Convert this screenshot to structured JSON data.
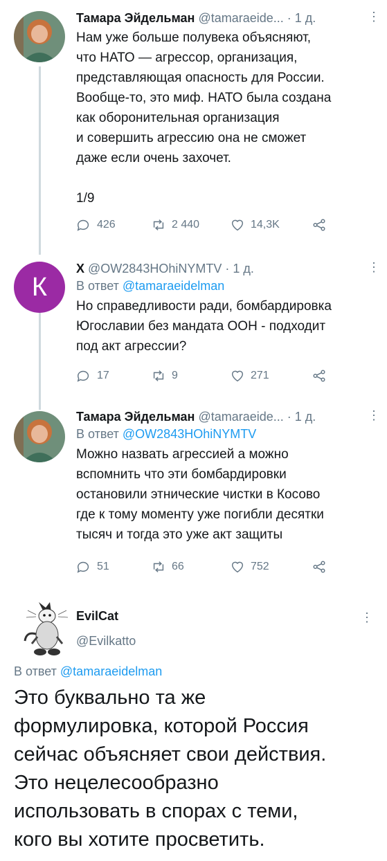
{
  "tweets": [
    {
      "name": "Тамара Эйдельман",
      "handle": "@tamaraeide...",
      "time": "1 д.",
      "reply_prefix": "",
      "reply_to": "",
      "text": "Нам уже больше полувека объясняют,\nчто НАТО — агрессор, организация,\nпредставляющая опасность для России.\nВообще-то, это миф. НАТО была создана\nкак оборонительная организация\nи совершить агрессию она не сможет\nдаже если очень захочет.\n\n1/9",
      "replies": "426",
      "retweets": "2 440",
      "likes": "14,3K"
    },
    {
      "name": "Х",
      "handle": "@OW2843HOhiNYMTV",
      "time": "1 д.",
      "reply_prefix": "В ответ",
      "reply_to": "@tamaraeidelman",
      "text": "Но справедливости ради, бомбардировка\nЮгославии без мандата ООН - подходит\nпод акт агрессии?",
      "replies": "17",
      "retweets": "9",
      "likes": "271",
      "avatar_letter": "К"
    },
    {
      "name": "Тамара Эйдельман",
      "handle": "@tamaraeide...",
      "time": "1 д.",
      "reply_prefix": "В ответ",
      "reply_to": "@OW2843HOhiNYMTV",
      "text": "Можно назвать агрессией а можно\nвспомнить что эти бомбардировки\nостановили этнические чистки в Косово\nгде к тому моменту уже погибли десятки\nтысяч и тогда это уже акт защиты",
      "replies": "51",
      "retweets": "66",
      "likes": "752"
    }
  ],
  "main": {
    "name": "EvilCat",
    "handle": "@Evilkatto",
    "reply_prefix": "В ответ",
    "reply_to": "@tamaraeidelman",
    "text": "Это буквально та же\nформулировка, которой Россия\nсейчас объясняет свои действия.\nЭто нецелесообразно\nиспользовать в спорах с теми,\nкого вы хотите просветить."
  },
  "colors": {
    "link": "#1d9bf0",
    "muted": "#657786",
    "k_avatar": "#9b2aa4",
    "thread_line": "#cfd9de"
  },
  "icons": [
    "reply-icon",
    "retweet-icon",
    "like-icon",
    "share-icon",
    "more-icon"
  ]
}
